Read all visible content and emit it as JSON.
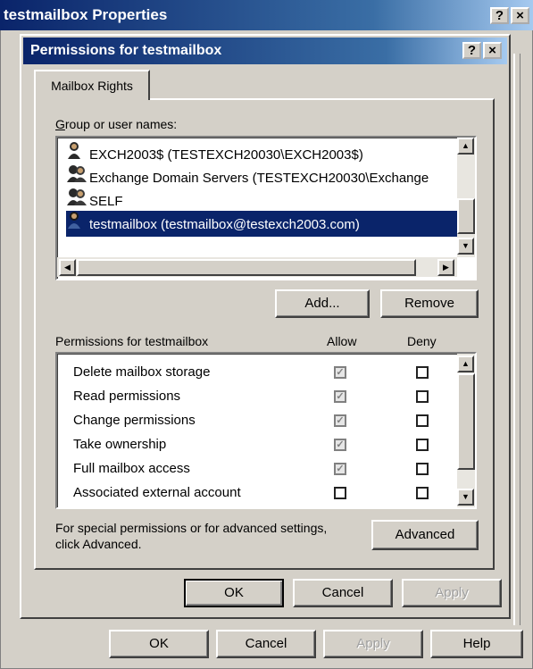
{
  "outer_window": {
    "title": "testmailbox Properties",
    "help_button": "?",
    "close_button": "×"
  },
  "dialog": {
    "title": "Permissions for testmailbox",
    "help_button": "?",
    "close_button": "×",
    "tab_label": "Mailbox Rights",
    "group_label": "Group or user names:",
    "users": [
      {
        "name": "EXCH2003$ (TESTEXCH20030\\EXCH2003$)",
        "icon": "user-icon",
        "selected": false
      },
      {
        "name": "Exchange Domain Servers (TESTEXCH20030\\Exchange",
        "icon": "group-icon",
        "selected": false
      },
      {
        "name": "SELF",
        "icon": "group-icon",
        "selected": false
      },
      {
        "name": "testmailbox (testmailbox@testexch2003.com)",
        "icon": "user-icon",
        "selected": true
      }
    ],
    "add_button": "Add...",
    "remove_button": "Remove",
    "permissions_label": "Permissions for testmailbox",
    "allow_header": "Allow",
    "deny_header": "Deny",
    "permissions": [
      {
        "name": "Delete mailbox storage",
        "allow": true,
        "deny": false
      },
      {
        "name": "Read permissions",
        "allow": true,
        "deny": false
      },
      {
        "name": "Change permissions",
        "allow": true,
        "deny": false
      },
      {
        "name": "Take ownership",
        "allow": true,
        "deny": false
      },
      {
        "name": "Full mailbox access",
        "allow": true,
        "deny": false
      },
      {
        "name": "Associated external account",
        "allow": false,
        "deny": false
      }
    ],
    "advanced_text_line1": "For special permissions or for advanced settings,",
    "advanced_text_line2": "click Advanced.",
    "advanced_button": "Advanced",
    "ok_button": "OK",
    "cancel_button": "Cancel",
    "apply_button": "Apply"
  },
  "outer_buttons": {
    "ok": "OK",
    "cancel": "Cancel",
    "apply": "Apply",
    "help": "Help"
  }
}
